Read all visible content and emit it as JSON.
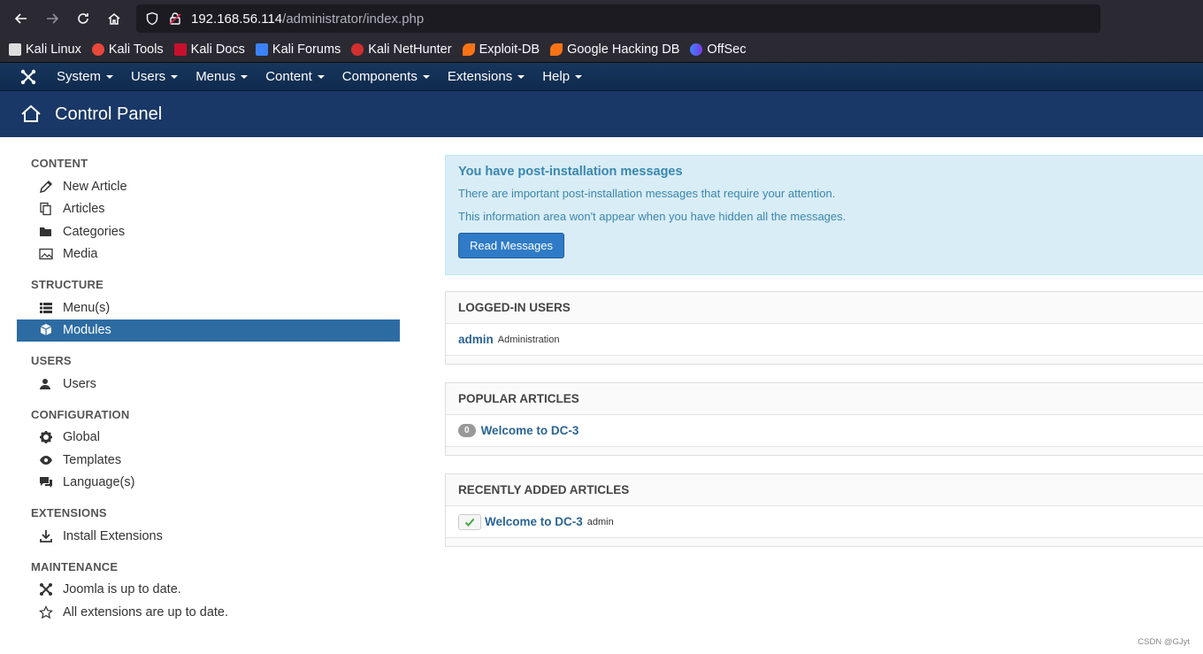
{
  "browser": {
    "url_host": "192.168.56.114",
    "url_path": "/administrator/index.php"
  },
  "bookmarks": [
    {
      "label": "Kali Linux",
      "icon": "kali-dragon-icon",
      "color": "#dddddd"
    },
    {
      "label": "Kali Tools",
      "icon": "kali-tools-icon",
      "color": "#e8473b"
    },
    {
      "label": "Kali Docs",
      "icon": "kali-docs-icon",
      "color": "#c8102e"
    },
    {
      "label": "Kali Forums",
      "icon": "kali-forums-icon",
      "color": "#3b82f6"
    },
    {
      "label": "Kali NetHunter",
      "icon": "nethunter-icon",
      "color": "#d32f2f"
    },
    {
      "label": "Exploit-DB",
      "icon": "exploit-db-icon",
      "color": "#f97316"
    },
    {
      "label": "Google Hacking DB",
      "icon": "ghdb-icon",
      "color": "#f97316"
    },
    {
      "label": "OffSec",
      "icon": "offsec-icon",
      "color": "#7c3aed"
    }
  ],
  "topnav": {
    "items": [
      "System",
      "Users",
      "Menus",
      "Content",
      "Components",
      "Extensions",
      "Help"
    ]
  },
  "header": {
    "title": "Control Panel"
  },
  "sidebar": {
    "sections": [
      {
        "title": "CONTENT",
        "items": [
          {
            "label": "New Article",
            "icon": "pencil-icon"
          },
          {
            "label": "Articles",
            "icon": "copy-icon"
          },
          {
            "label": "Categories",
            "icon": "folder-open-icon"
          },
          {
            "label": "Media",
            "icon": "image-icon"
          }
        ]
      },
      {
        "title": "STRUCTURE",
        "items": [
          {
            "label": "Menu(s)",
            "icon": "list-icon"
          },
          {
            "label": "Modules",
            "icon": "cube-icon",
            "active": true
          }
        ]
      },
      {
        "title": "USERS",
        "items": [
          {
            "label": "Users",
            "icon": "user-icon"
          }
        ]
      },
      {
        "title": "CONFIGURATION",
        "items": [
          {
            "label": "Global",
            "icon": "cog-icon"
          },
          {
            "label": "Templates",
            "icon": "eye-icon"
          },
          {
            "label": "Language(s)",
            "icon": "comments-icon"
          }
        ]
      },
      {
        "title": "EXTENSIONS",
        "items": [
          {
            "label": "Install Extensions",
            "icon": "download-icon"
          }
        ]
      },
      {
        "title": "MAINTENANCE",
        "items": [
          {
            "label": "Joomla is up to date.",
            "icon": "joomla-icon"
          },
          {
            "label": "All extensions are up to date.",
            "icon": "star-icon"
          }
        ]
      }
    ]
  },
  "alert": {
    "title": "You have post-installation messages",
    "line1": "There are important post-installation messages that require your attention.",
    "line2": "This information area won't appear when you have hidden all the messages.",
    "button": "Read Messages"
  },
  "logged_in": {
    "title": "LOGGED-IN USERS",
    "user": "admin",
    "role": "Administration"
  },
  "popular": {
    "title": "POPULAR ARTICLES",
    "hits": "0",
    "article": "Welcome to DC-3"
  },
  "recent": {
    "title": "RECENTLY ADDED ARTICLES",
    "article": "Welcome to DC-3",
    "author": "admin"
  },
  "watermark": "CSDN @GJyt"
}
